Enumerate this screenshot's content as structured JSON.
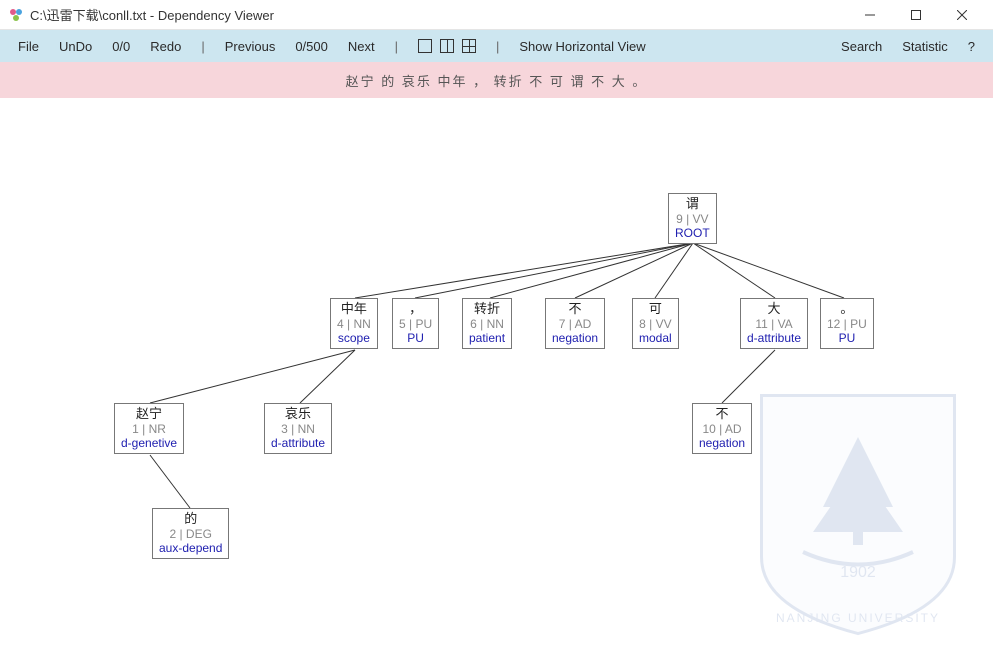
{
  "window": {
    "title": "C:\\迅雷下载\\conll.txt - Dependency Viewer"
  },
  "toolbar": {
    "file": "File",
    "undo": "UnDo",
    "undo_count": "0/0",
    "redo": "Redo",
    "previous": "Previous",
    "page": "0/500",
    "next": "Next",
    "horizontal": "Show Horizontal View",
    "search": "Search",
    "statistic": "Statistic",
    "help": "?"
  },
  "sentence": "赵宁 的 哀乐 中年 ， 转折 不 可 谓 不 大 。",
  "watermark": {
    "year": "1902",
    "name": "NANJING UNIVERSITY"
  },
  "nodes": {
    "n9": {
      "word": "谓",
      "pos": "9 | VV",
      "rel": "ROOT"
    },
    "n4": {
      "word": "中年",
      "pos": "4 | NN",
      "rel": "scope"
    },
    "n5": {
      "word": "，",
      "pos": "5 | PU",
      "rel": "PU"
    },
    "n6": {
      "word": "转折",
      "pos": "6 | NN",
      "rel": "patient"
    },
    "n7": {
      "word": "不",
      "pos": "7 | AD",
      "rel": "negation"
    },
    "n8": {
      "word": "可",
      "pos": "8 | VV",
      "rel": "modal"
    },
    "n11": {
      "word": "大",
      "pos": "11 | VA",
      "rel": "d-attribute"
    },
    "n12": {
      "word": "。",
      "pos": "12 | PU",
      "rel": "PU"
    },
    "n1": {
      "word": "赵宁",
      "pos": "1 | NR",
      "rel": "d-genetive"
    },
    "n3": {
      "word": "哀乐",
      "pos": "3 | NN",
      "rel": "d-attribute"
    },
    "n10": {
      "word": "不",
      "pos": "10 | AD",
      "rel": "negation"
    },
    "n2": {
      "word": "的",
      "pos": "2 | DEG",
      "rel": "aux-depend"
    }
  }
}
